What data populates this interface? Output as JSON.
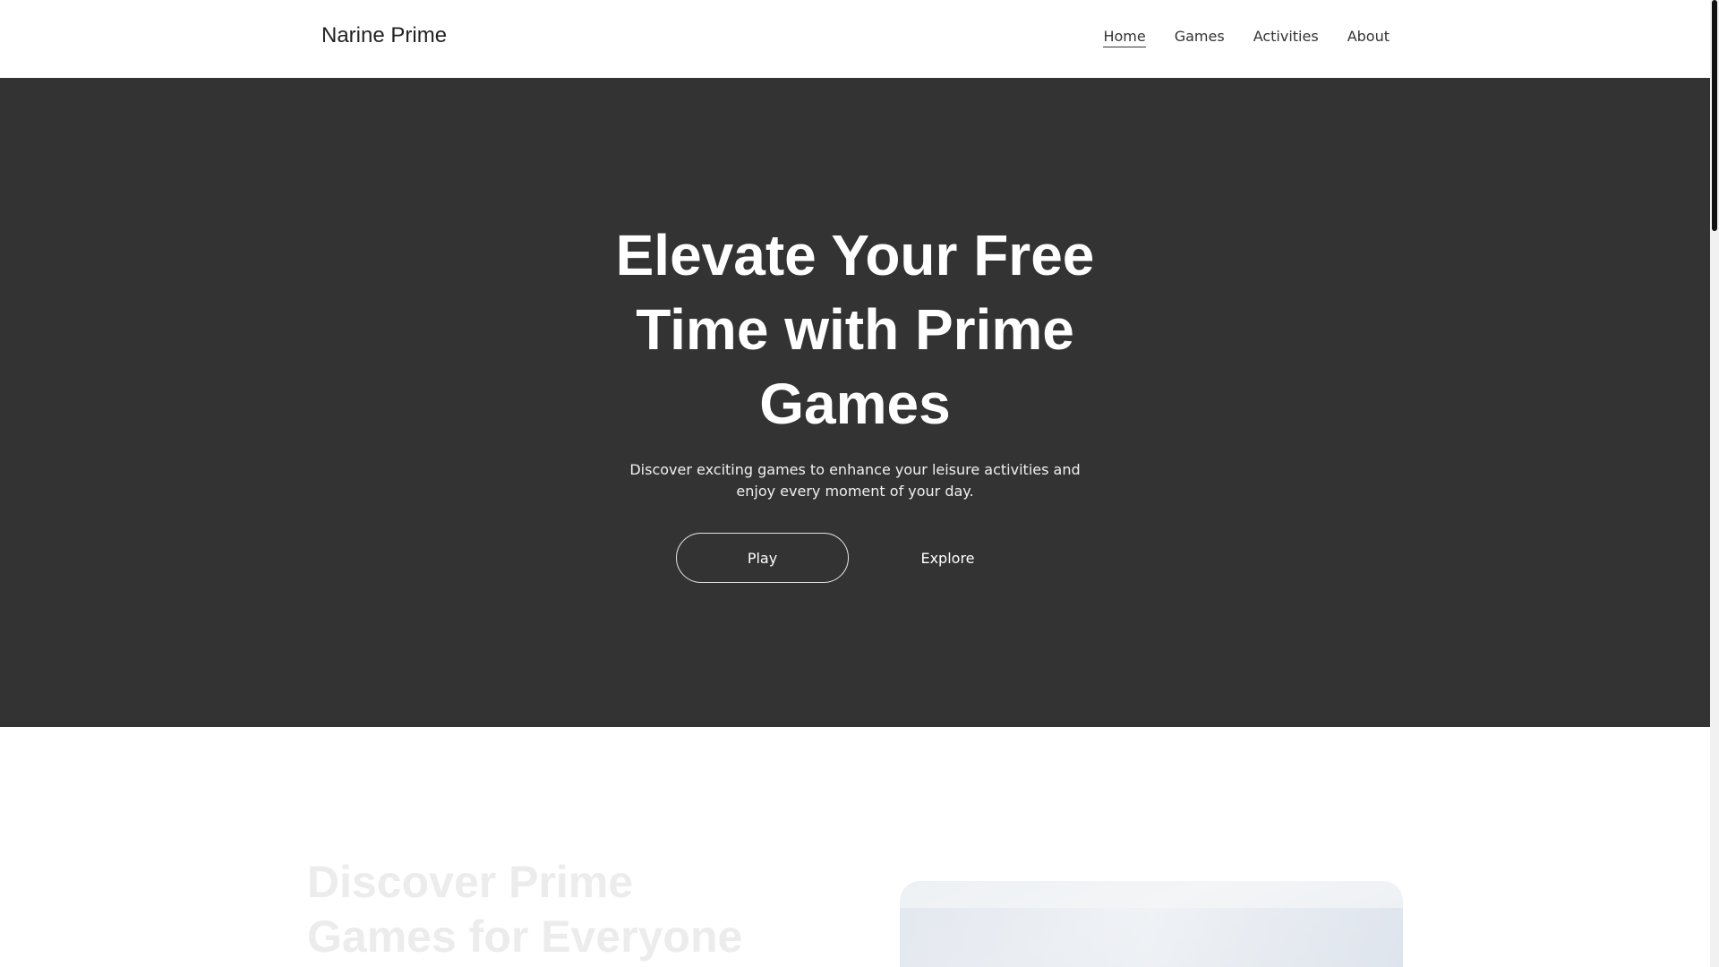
{
  "navbar": {
    "brand": "Narine Prime",
    "links": [
      {
        "label": "Home",
        "active": true
      },
      {
        "label": "Games",
        "active": false
      },
      {
        "label": "Activities",
        "active": false
      },
      {
        "label": "About",
        "active": false
      }
    ]
  },
  "hero": {
    "title": "Elevate Your Free Time with Prime Games",
    "subtitle": "Discover exciting games to enhance your leisure activities and enjoy every moment of your day.",
    "play_label": "Play",
    "explore_label": "Explore"
  },
  "section": {
    "title": "Discover Prime Games for Everyone"
  },
  "colors": {
    "hero_background": "#333333",
    "navbar_background": "#ffffff",
    "hero_text": "#ffffff",
    "scrollbar_thumb": "#111111"
  }
}
